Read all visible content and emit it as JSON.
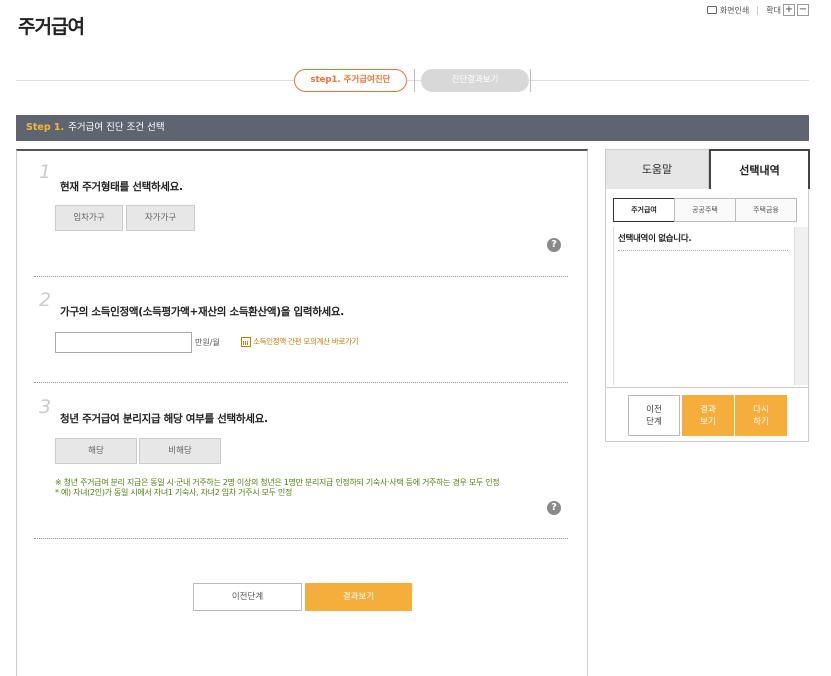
{
  "page": {
    "title": "주거급여"
  },
  "util": {
    "print_label": "화면인쇄",
    "zoom_label": "확대",
    "zoom_in": "+",
    "zoom_out": "−"
  },
  "steps": {
    "step1": "step1. 주거급여진단",
    "step2": "진단결과보기"
  },
  "section": {
    "step_no": "Step 1.",
    "title": "주거급여 진단 조건 선택"
  },
  "questions": [
    {
      "number": "1",
      "title": "현재 주거형태를 선택하세요.",
      "options": [
        "임차가구",
        "자가가구"
      ]
    },
    {
      "number": "2",
      "title": "가구의 소득인정액(소득평가액+재산의 소득환산액)을 입력하세요.",
      "input_value": "",
      "unit": "만원/월",
      "link": "소득인정액 간편 모의계산 바로가기"
    },
    {
      "number": "3",
      "title": "청년 주거급여 분리지급 해당 여부를 선택하세요.",
      "options": [
        "해당",
        "비해당"
      ],
      "notice_1": "※ 청년 주거급여 분리 지급은 동일 시·군내 거주하는 2명 이상의 청년은 1명만 분리지급 인정하되 기숙사·사택 등에 거주하는 경우 모두 인정",
      "notice_2": "* 예) 자녀(2인)가 동일 시에서 자녀1 기숙사, 자녀2 임차 거주시 모두 인정"
    }
  ],
  "help_icon": "?",
  "nav": {
    "prev": "이전단계",
    "result": "결과보기"
  },
  "side": {
    "tab_help": "도움말",
    "tab_selection": "선택내역",
    "sub_tabs": [
      "주거급여",
      "공공주택",
      "주택금융"
    ],
    "empty_text": "선택내역이 없습니다.",
    "buttons": {
      "prev": "이전\n단계",
      "result": "결과\n보기",
      "again": "다시\n하기"
    }
  },
  "colors": {
    "accent": "#f5ad3b",
    "step_active": "#e8733a",
    "bar": "#5e6571",
    "notice": "#4e7f0c"
  }
}
